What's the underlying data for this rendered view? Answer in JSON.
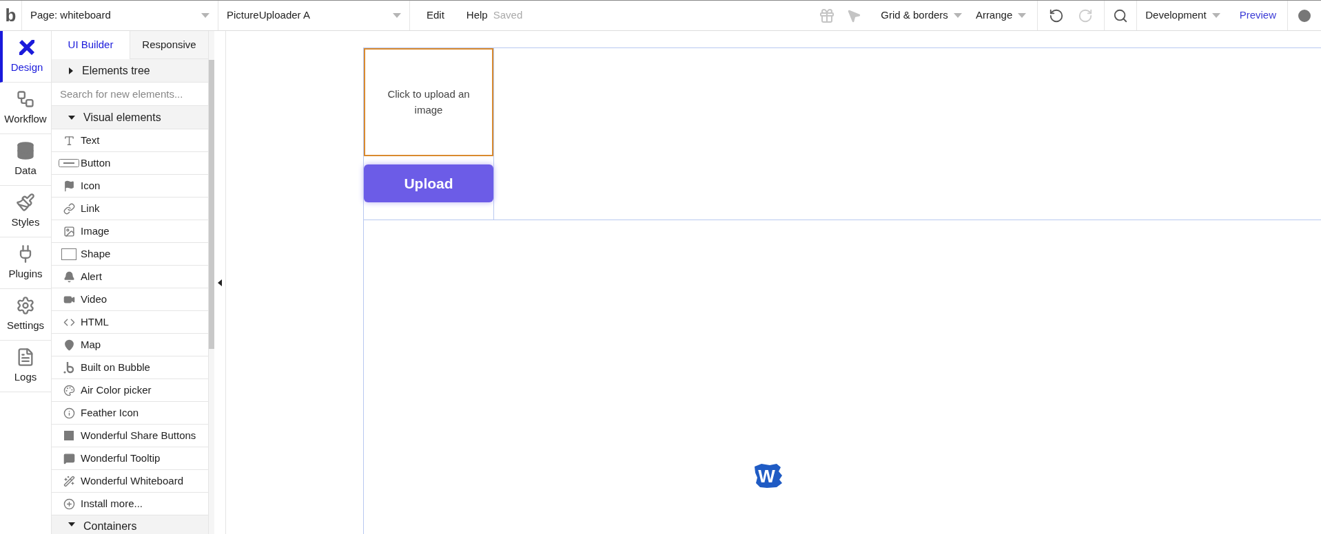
{
  "top_bar": {
    "logo": "b",
    "page_dropdown": "Page: whiteboard",
    "element_dropdown": "PictureUploader A",
    "menu": [
      "Edit",
      "Help"
    ],
    "save_status": "Saved",
    "grid_menu": "Grid & borders",
    "arrange_menu": "Arrange",
    "environment_dropdown": "Development",
    "preview_link": "Preview"
  },
  "rail": [
    {
      "label": "Design",
      "selected": true
    },
    {
      "label": "Workflow",
      "selected": false
    },
    {
      "label": "Data",
      "selected": false
    },
    {
      "label": "Styles",
      "selected": false
    },
    {
      "label": "Plugins",
      "selected": false
    },
    {
      "label": "Settings",
      "selected": false
    },
    {
      "label": "Logs",
      "selected": false
    }
  ],
  "panel_tabs": [
    {
      "label": "UI Builder",
      "selected": true
    },
    {
      "label": "Responsive",
      "selected": false
    }
  ],
  "elements_tree": {
    "label": "Elements tree",
    "expanded": false
  },
  "search": {
    "placeholder": "Search for new elements..."
  },
  "visual_elements": {
    "label": "Visual elements",
    "expanded": true,
    "items": [
      {
        "label": "Text"
      },
      {
        "label": "Button"
      },
      {
        "label": "Icon"
      },
      {
        "label": "Link"
      },
      {
        "label": "Image"
      },
      {
        "label": "Shape"
      },
      {
        "label": "Alert"
      },
      {
        "label": "Video"
      },
      {
        "label": "HTML"
      },
      {
        "label": "Map"
      },
      {
        "label": "Built on Bubble"
      },
      {
        "label": "Air Color picker"
      },
      {
        "label": "Feather Icon"
      },
      {
        "label": "Wonderful Share Buttons"
      },
      {
        "label": "Wonderful Tooltip"
      },
      {
        "label": "Wonderful Whiteboard"
      },
      {
        "label": "Install more..."
      }
    ]
  },
  "next_section": {
    "label": "Containers"
  },
  "canvas": {
    "uploader_text": "Click to upload an image",
    "upload_button": "Upload",
    "logo_letter": "W"
  }
}
